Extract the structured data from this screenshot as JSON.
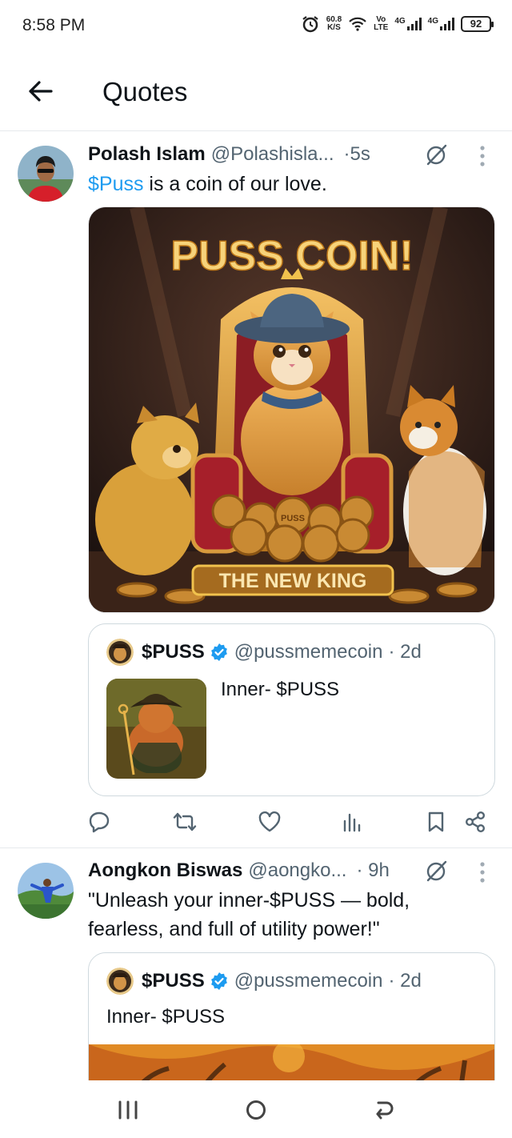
{
  "status_bar": {
    "time": "8:58 PM",
    "net_speed": "60.8",
    "net_unit": "K/S",
    "volte": "Vo",
    "volte_sub": "LTE",
    "sim1": "4G",
    "sim2": "4G",
    "battery": "92"
  },
  "header": {
    "title": "Quotes"
  },
  "posts": [
    {
      "author": "Polash Islam",
      "handle": "@Polashisla...",
      "time": "·5s",
      "text_cashtag": "$Puss",
      "text_rest": " is a coin of our love.",
      "media": {
        "title": "PUSS COIN!",
        "banner": "THE NEW KING",
        "coin_label": "PUSS"
      },
      "quote": {
        "name": "$PUSS",
        "handle": "@pussmemecoin",
        "time": "· 2d",
        "text": "Inner- $PUSS"
      }
    },
    {
      "author": "Aongkon Biswas",
      "handle": "@aongko...",
      "time": "· 9h",
      "text": "\"Unleash your inner-$PUSS — bold, fearless, and full of utility power!\"",
      "quote": {
        "name": "$PUSS",
        "handle": "@pussmemecoin",
        "time": "· 2d",
        "text": "Inner- $PUSS"
      }
    }
  ],
  "colors": {
    "accent": "#1d9bf0",
    "secondary_text": "#536471",
    "border": "#cfd9de"
  }
}
